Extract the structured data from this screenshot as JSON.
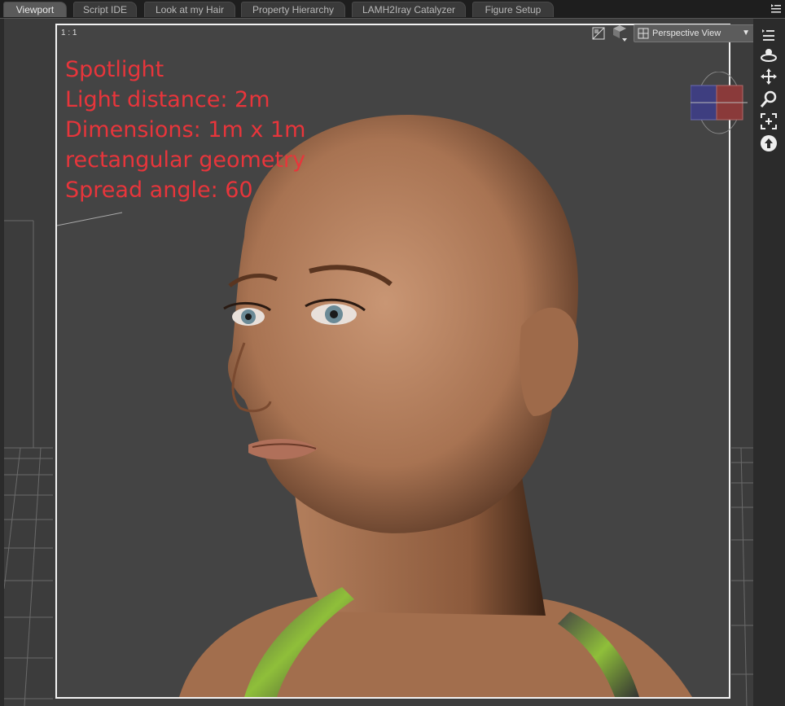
{
  "tabs": [
    {
      "label": "Viewport",
      "active": true
    },
    {
      "label": "Script IDE",
      "active": false
    },
    {
      "label": "Look at my Hair",
      "active": false
    },
    {
      "label": "Property Hierarchy",
      "active": false
    },
    {
      "label": "LAMH2Iray Catalyzer",
      "active": false
    },
    {
      "label": "Figure Setup",
      "active": false
    }
  ],
  "viewport": {
    "ratio_label": "1 : 1",
    "view_select": "Perspective View",
    "overlay": {
      "color": "#e8353b",
      "lines": [
        "Spotlight",
        "Light distance: 2m",
        "Dimensions: 1m x 1m",
        "rectangular geometry",
        "Spread angle: 60"
      ]
    }
  },
  "right_tools": [
    "orbit-icon",
    "pan-icon",
    "zoom-icon",
    "frame-icon",
    "reset-view-icon"
  ],
  "colors": {
    "background": "#3c3c3c",
    "frame_border": "#f2f2f2",
    "skin": "#b98462",
    "axis_blue": "#3e3e80",
    "axis_red": "#8a3a3a"
  }
}
